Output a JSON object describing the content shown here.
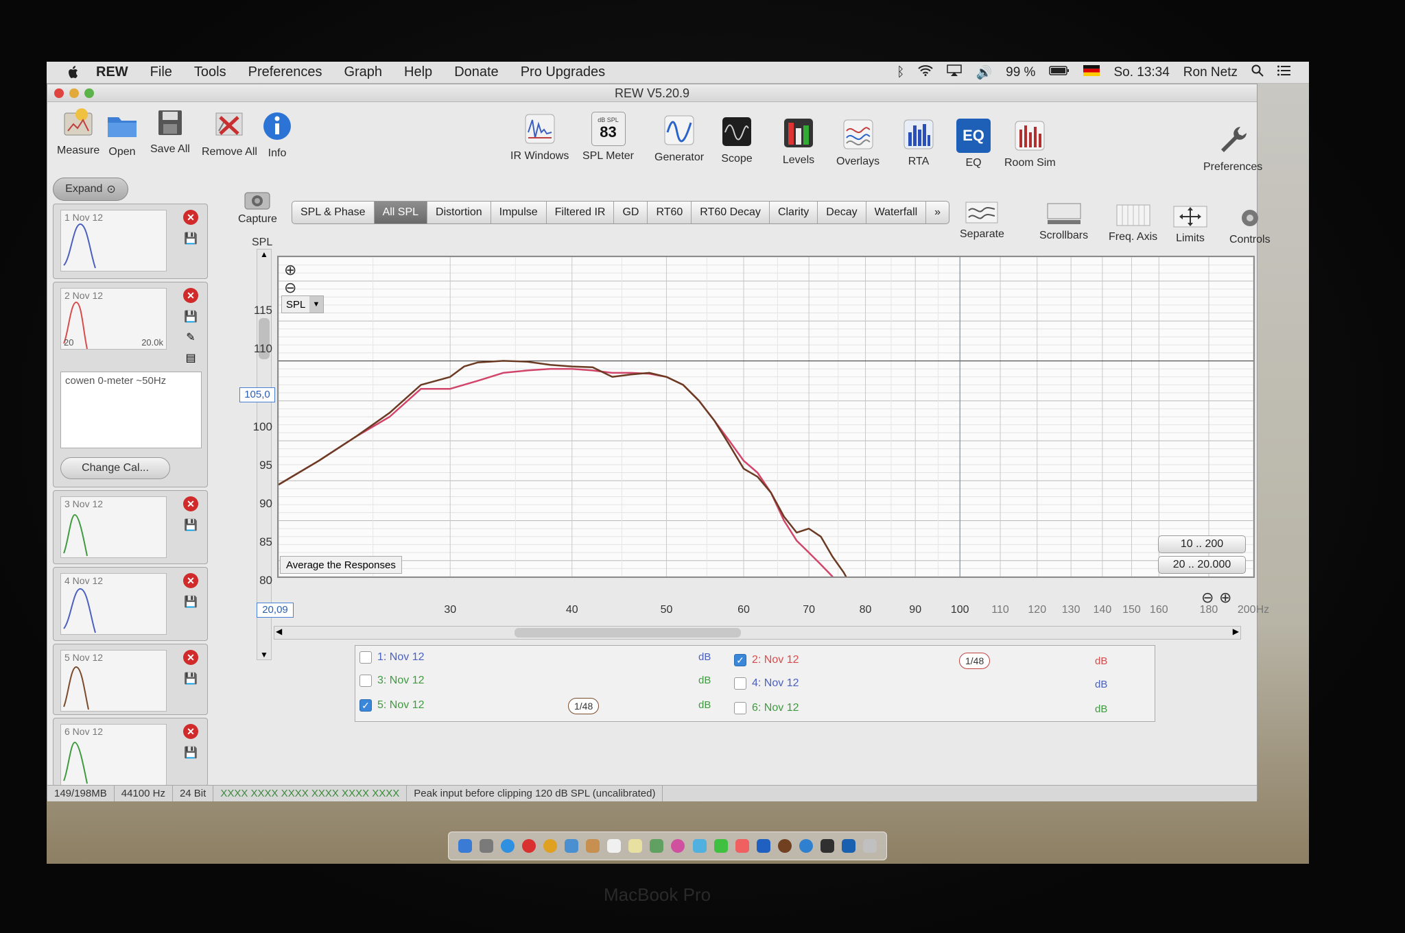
{
  "menubar": {
    "items": [
      "REW",
      "File",
      "Tools",
      "Preferences",
      "Graph",
      "Help",
      "Donate",
      "Pro Upgrades"
    ],
    "battery": "99 %",
    "clock": "So. 13:34",
    "user": "Ron Netz"
  },
  "window": {
    "title": "REW V5.20.9"
  },
  "toolbar": {
    "measure": "Measure",
    "open": "Open",
    "save_all": "Save All",
    "remove_all": "Remove All",
    "info": "Info",
    "ir_windows": "IR Windows",
    "spl_meter": "SPL Meter",
    "spl_meter_small": "dB SPL",
    "spl_meter_value": "83",
    "generator": "Generator",
    "scope": "Scope",
    "levels": "Levels",
    "overlays": "Overlays",
    "rta": "RTA",
    "eq": "EQ",
    "eq_icon_text": "EQ",
    "room_sim": "Room Sim",
    "preferences": "Preferences",
    "capture": "Capture",
    "separate": "Separate",
    "scrollbars": "Scrollbars",
    "freq_axis": "Freq. Axis",
    "limits": "Limits",
    "controls": "Controls"
  },
  "sidebar": {
    "expand": "Expand",
    "measurements": [
      {
        "label": "1 Nov 12",
        "color": "#4a5fbf"
      },
      {
        "label": "2 Nov 12",
        "color": "#d94b4b",
        "axis_left": "20",
        "axis_right": "20.0k"
      },
      {
        "label": "3 Nov 12",
        "color": "#3f9a3f"
      },
      {
        "label": "4 Nov 12",
        "color": "#4a5fbf"
      },
      {
        "label": "5 Nov 12",
        "color": "#7a4a2a"
      },
      {
        "label": "6 Nov 12",
        "color": "#3f9a3f"
      }
    ],
    "notes": "cowen 0-meter ~50Hz",
    "change_cal": "Change Cal..."
  },
  "tabs": [
    "SPL & Phase",
    "All SPL",
    "Distortion",
    "Impulse",
    "Filtered IR",
    "GD",
    "RT60",
    "RT60 Decay",
    "Clarity",
    "Decay",
    "Waterfall",
    "»"
  ],
  "active_tab": "All SPL",
  "graph": {
    "y_axis_title": "SPL",
    "selector": "SPL",
    "cursor_y": "105,0",
    "cursor_x": "20,09",
    "average_button": "Average the Responses",
    "range_10_200": "10 .. 200",
    "range_20_20000": "20 .. 20.000",
    "y_ticks": [
      "115",
      "110",
      "105",
      "100",
      "95",
      "90",
      "85",
      "80"
    ],
    "x_ticks": [
      "30",
      "40",
      "50",
      "60",
      "70",
      "80",
      "90",
      "100",
      "110",
      "120",
      "130",
      "140",
      "150",
      "160",
      "180",
      "200Hz"
    ]
  },
  "chart_data": {
    "type": "line",
    "xlabel": "",
    "ylabel": "SPL",
    "xscale": "log",
    "xlim": [
      20,
      200
    ],
    "ylim": [
      78,
      118
    ],
    "grid": true,
    "series": [
      {
        "name": "5: Nov 12",
        "color": "#6b3a22",
        "x": [
          20,
          22,
          24,
          26,
          28,
          29,
          30,
          31,
          32,
          34,
          36,
          38,
          40,
          42,
          44,
          46,
          48,
          50,
          52,
          54,
          56,
          58,
          60,
          62,
          64,
          66,
          68,
          70,
          72,
          74,
          76,
          78
        ],
        "y": [
          89.5,
          92.5,
          95.5,
          98.5,
          102.0,
          102.5,
          103.0,
          104.3,
          104.8,
          105.0,
          104.9,
          104.5,
          104.3,
          104.2,
          103.0,
          103.3,
          103.5,
          103.0,
          102.0,
          100.0,
          97.5,
          94.5,
          91.5,
          90.5,
          88.5,
          85.5,
          83.5,
          84.0,
          83.0,
          80.5,
          78.5,
          76.0
        ]
      },
      {
        "name": "2: Nov 12",
        "color": "#d2456a",
        "x": [
          20,
          22,
          24,
          26,
          28,
          30,
          32,
          34,
          36,
          38,
          40,
          42,
          44,
          46,
          48,
          50,
          52,
          54,
          56,
          58,
          60,
          62,
          64,
          66,
          68,
          70,
          72,
          74,
          76
        ],
        "y": [
          89.5,
          92.5,
          95.5,
          98.0,
          101.5,
          101.5,
          102.5,
          103.5,
          103.8,
          104.0,
          104.0,
          103.8,
          103.5,
          103.5,
          103.4,
          103.0,
          102.0,
          100.0,
          97.5,
          95.0,
          92.5,
          91.0,
          88.5,
          85.0,
          82.5,
          81.0,
          79.5,
          78.0,
          76.0
        ]
      }
    ]
  },
  "legend": {
    "items": [
      {
        "label": "1: Nov 12",
        "checked": false,
        "color": "#4a5fbf",
        "unit": "dB"
      },
      {
        "label": "2: Nov 12",
        "checked": true,
        "color": "#d94b4b",
        "unit": "dB",
        "smoothing": "1/48"
      },
      {
        "label": "3: Nov 12",
        "checked": false,
        "color": "#3f9a3f",
        "unit": "dB"
      },
      {
        "label": "4: Nov 12",
        "checked": false,
        "color": "#4a5fbf",
        "unit": "dB"
      },
      {
        "label": "5: Nov 12",
        "checked": true,
        "color": "#3f9a3f",
        "unit": "dB",
        "smoothing": "1/48"
      },
      {
        "label": "6: Nov 12",
        "checked": false,
        "color": "#3f9a3f",
        "unit": "dB"
      }
    ]
  },
  "statusbar": {
    "memory": "149/198MB",
    "samplerate": "44100 Hz",
    "bits": "24 Bit",
    "meters": "XXXX XXXX  XXXX XXXX  XXXX XXXX",
    "message": "Peak input before clipping 120 dB SPL (uncalibrated)"
  },
  "laptop": {
    "brand": "MacBook Pro"
  }
}
